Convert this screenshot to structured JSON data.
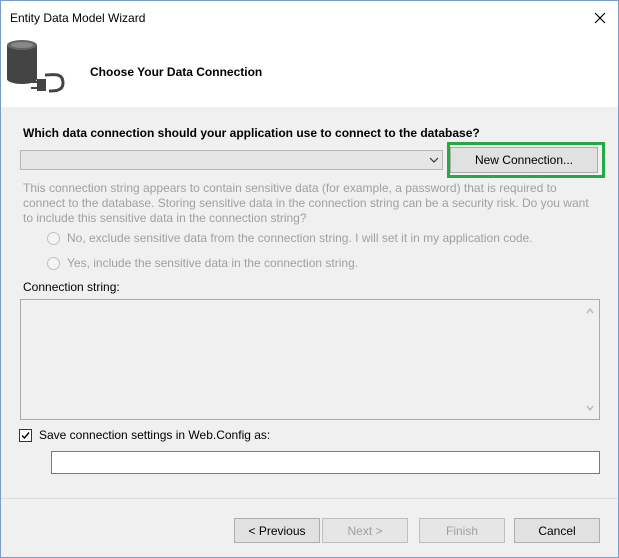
{
  "window": {
    "title": "Entity Data Model Wizard",
    "close_icon": "close-icon"
  },
  "header": {
    "icon": "database-plug-icon",
    "title": "Choose Your Data Connection"
  },
  "connection": {
    "question": "Which data connection should your application use to connect to the database?",
    "selected_value": "",
    "new_connection_label": "New Connection...",
    "sensitive_info": "This connection string appears to contain sensitive data (for example, a password) that is required to connect to the database. Storing sensitive data in the connection string can be a security risk. Do you want to include this sensitive data in the connection string?",
    "radio_exclude_label": "No, exclude sensitive data from the connection string. I will set it in my application code.",
    "radio_include_label": "Yes, include the sensitive data in the connection string.",
    "connection_string_label": "Connection string:",
    "connection_string_value": ""
  },
  "save": {
    "checkbox_label": "Save connection settings in Web.Config as:",
    "checked": true,
    "value": ""
  },
  "footer": {
    "previous_label": "< Previous",
    "next_label": "Next >",
    "finish_label": "Finish",
    "cancel_label": "Cancel"
  },
  "colors": {
    "highlight": "#26a843",
    "disabled_text": "#a0a0a0"
  }
}
